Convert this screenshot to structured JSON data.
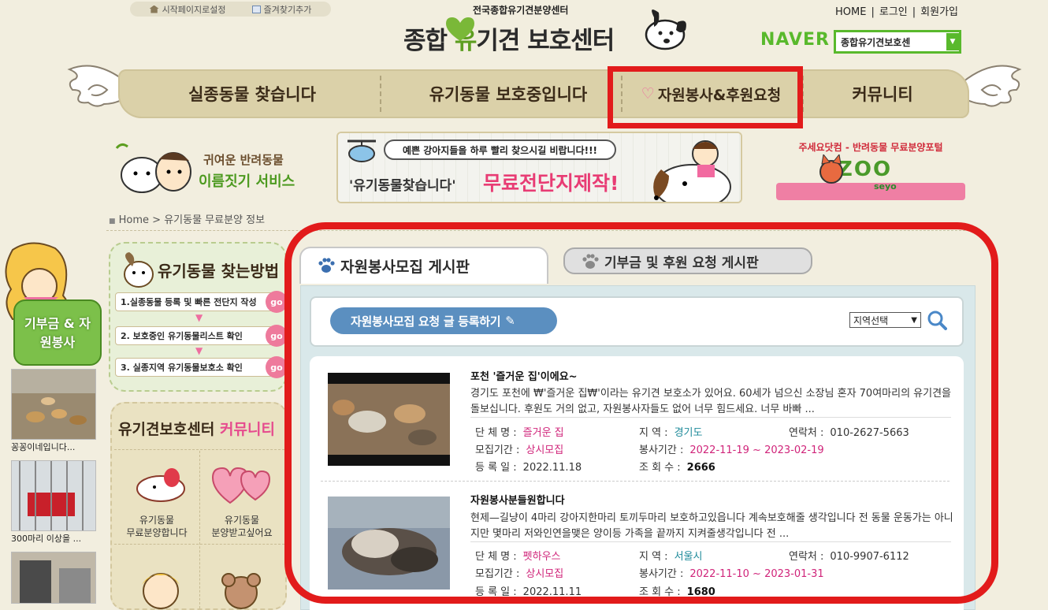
{
  "top": {
    "start_page": "시작페이지로설정",
    "bookmark": "즐겨찾기추가",
    "logo_sub": "전국종합유기견분양센터",
    "logo_main_pre": "종합",
    "logo_main_green": "유",
    "logo_main_post": "기견 보호센터",
    "links": [
      "HOME",
      "로그인",
      "회원가입"
    ],
    "naver_label": "NAVER",
    "naver_select": "종합유기견보호센"
  },
  "nav": {
    "items": [
      "실종동물 찾습니다",
      "유기동물 보호중입니다",
      "자원봉사&후원요청",
      "커뮤니티"
    ]
  },
  "banners": {
    "left_title": "귀여운 반려동물",
    "left_sub": "이름짓기 서비스",
    "mid_top": "예쁜 강아지들을 하루 빨리 찾으시길 비랍니다!!!",
    "mid_left": "'유기동물찾습니다'",
    "mid_right": "무료전단지제작!",
    "right_title": "주세요닷컴 - 반려동물 무료분양포털",
    "right_logo": "ZOO",
    "right_logo_sub": "seyo"
  },
  "breadcrumb": "Home > 유기동물 무료분양 정보",
  "sidebar": {
    "badge": "기부금 & 자원봉사",
    "thumbs": [
      {
        "caption": "꽁꽁이네입니다..."
      },
      {
        "caption": "300마리 이상을 ..."
      },
      {
        "caption": ""
      }
    ]
  },
  "guide": {
    "title": "유기동물 찾는방법",
    "steps": [
      "1.실종동물 등록 및 빠른 전단지 작성",
      "2. 보호중인 유기동물리스트 확인",
      "3. 실종지역 유기동물보호소 확인"
    ],
    "go": "go"
  },
  "community": {
    "title_pre": "유기견보호센터",
    "title_pink": "커뮤니티",
    "items": [
      {
        "line1": "유기동물",
        "line2": "무료분양합니다"
      },
      {
        "line1": "유기동물",
        "line2": "분양받고싶어요"
      }
    ]
  },
  "board": {
    "tab_active": "자원봉사모집 게시판",
    "tab_inactive": "기부금 및 후원 요청 게시판",
    "request_button": "자원봉사모집 요청 글 등록하기",
    "region_select": "지역선택",
    "labels": {
      "org": "단 체 명 :",
      "region": "지    역 :",
      "contact": "연락처 :",
      "recruit": "모집기간 :",
      "period": "봉사기간 :",
      "date": "등 록 일 :",
      "views": "조 회 수 :"
    },
    "posts": [
      {
        "title": "포천 '즐거운 집'이에요~",
        "body": "경기도 포천에 ₩'즐거운 집₩'이라는 유기견 보호소가 있어요. 60세가 넘으신 소장님 혼자 70여마리의 유기견을 돌보십니다. 후원도 거의 없고, 자원봉사자들도 없어 너무 힘드세요. 너무 바빠 ...",
        "org": "즐거운 집",
        "region": "경기도",
        "contact": "010-2627-5663",
        "recruit": "상시모집",
        "period": "2022-11-19 ~ 2023-02-19",
        "date": "2022.11.18",
        "views": "2666"
      },
      {
        "title": "자원봉사분들원합니다",
        "body": "현제—길냥이 4마리 강아지한마리 토끼두마리 보호하고있읍니다 계속보호해줄 생각입니다 전 동물 운동가는 아니지만 몇마리 저와인연을맺은 양이등 가족을 끝까지 지켜줄생각입니다 전 ...",
        "org": "펫하우스",
        "region": "서울시",
        "contact": "010-9907-6112",
        "recruit": "상시모집",
        "period": "2022-11-10 ~ 2023-01-31",
        "date": "2022.11.11",
        "views": "1680"
      }
    ]
  },
  "colors": {
    "background": "#f2eedf",
    "highlight_red": "#e21b1b",
    "naver_green": "#59b92c",
    "pink": "#d0247a",
    "teal": "#1e8a9a"
  }
}
